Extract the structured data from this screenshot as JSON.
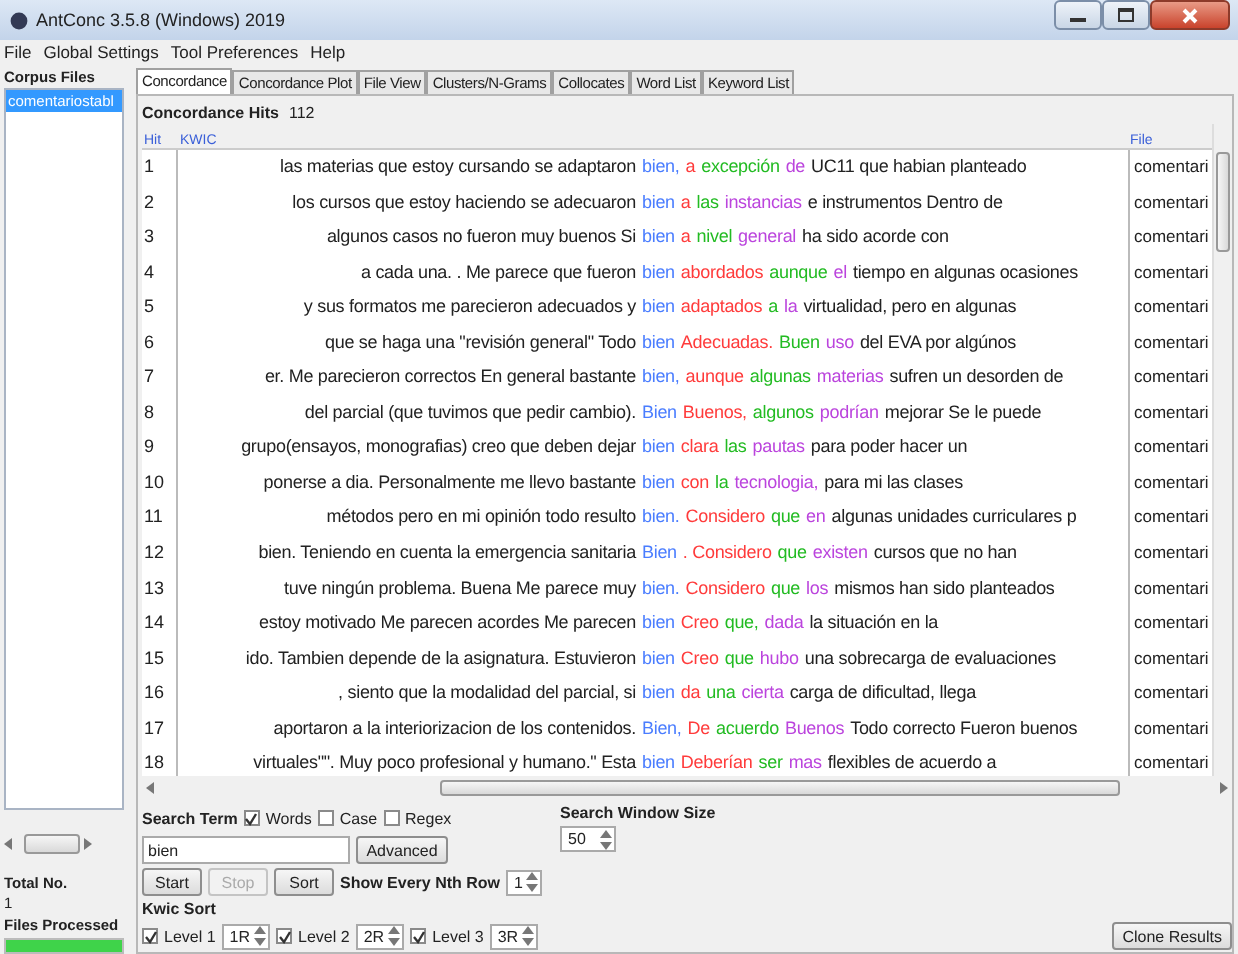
{
  "window": {
    "title": "AntConc 3.5.8 (Windows) 2019"
  },
  "menu": [
    "File",
    "Global Settings",
    "Tool Preferences",
    "Help"
  ],
  "sidebar": {
    "title": "Corpus Files",
    "files": [
      {
        "name": "comentariostabl",
        "selected": true
      }
    ],
    "total_label": "Total No.",
    "total": "1",
    "processed_label": "Files Processed",
    "progress": {
      "level": 1
    }
  },
  "tabs": [
    {
      "label": "Concordance",
      "selected": true
    },
    {
      "label": "Concordance Plot",
      "selected": false
    },
    {
      "label": "File View",
      "selected": false
    },
    {
      "label": "Clusters/N-Grams",
      "selected": false
    },
    {
      "label": "Collocates",
      "selected": false
    },
    {
      "label": "Word List",
      "selected": false
    },
    {
      "label": "Keyword List",
      "selected": false
    }
  ],
  "hits": {
    "label": "Concordance Hits",
    "count": "112"
  },
  "table": {
    "columns": [
      "Hit",
      "KWIC",
      "File"
    ],
    "rows": [
      {
        "hit": "1",
        "left": "las materias que estoy cursando se adaptaron",
        "right": [
          {
            "text": "bien,",
            "color": "#4a7dff"
          },
          {
            "text": "a",
            "color": "#ff3b3b"
          },
          {
            "text": "excepción",
            "color": "#22bb22"
          },
          {
            "text": "de",
            "color": "#bb44dd"
          },
          {
            "text": "UC11 que habian planteado",
            "color": "#222222"
          }
        ],
        "file": "comentari"
      },
      {
        "hit": "2",
        "left": "los cursos que estoy haciendo se adecuaron",
        "right": [
          {
            "text": "bien",
            "color": "#4a7dff"
          },
          {
            "text": "a",
            "color": "#ff3b3b"
          },
          {
            "text": "las",
            "color": "#22bb22"
          },
          {
            "text": "instancias",
            "color": "#bb44dd"
          },
          {
            "text": "e instrumentos Dentro de",
            "color": "#222222"
          }
        ],
        "file": "comentari"
      },
      {
        "hit": "3",
        "left": "algunos casos no fueron muy buenos  Si",
        "right": [
          {
            "text": "bien",
            "color": "#4a7dff"
          },
          {
            "text": "a",
            "color": "#ff3b3b"
          },
          {
            "text": "nivel",
            "color": "#22bb22"
          },
          {
            "text": "general",
            "color": "#bb44dd"
          },
          {
            "text": "ha sido acorde con",
            "color": "#222222"
          }
        ],
        "file": "comentari"
      },
      {
        "hit": "4",
        "left": "a cada una. . Me parece que fueron",
        "right": [
          {
            "text": "bien",
            "color": "#4a7dff"
          },
          {
            "text": "abordados",
            "color": "#ff3b3b"
          },
          {
            "text": "aunque",
            "color": "#22bb22"
          },
          {
            "text": "el",
            "color": "#bb44dd"
          },
          {
            "text": "tiempo en algunas ocasiones",
            "color": "#222222"
          }
        ],
        "file": "comentari"
      },
      {
        "hit": "5",
        "left": "y sus formatos me parecieron adecuados y",
        "right": [
          {
            "text": "bien",
            "color": "#4a7dff"
          },
          {
            "text": "adaptados",
            "color": "#ff3b3b"
          },
          {
            "text": "a",
            "color": "#22bb22"
          },
          {
            "text": "la",
            "color": "#bb44dd"
          },
          {
            "text": "virtualidad, pero en algunas",
            "color": "#222222"
          }
        ],
        "file": "comentari"
      },
      {
        "hit": "6",
        "left": "que se haga una \"revisión general\" Todo",
        "right": [
          {
            "text": "bien",
            "color": "#4a7dff"
          },
          {
            "text": "Adecuadas.",
            "color": "#ff3b3b"
          },
          {
            "text": "Buen",
            "color": "#22bb22"
          },
          {
            "text": "uso",
            "color": "#bb44dd"
          },
          {
            "text": "del EVA por algúnos",
            "color": "#222222"
          }
        ],
        "file": "comentari"
      },
      {
        "hit": "7",
        "left": "er.  Me parecieron correctos  En general bastante",
        "right": [
          {
            "text": "bien,",
            "color": "#4a7dff"
          },
          {
            "text": "aunque",
            "color": "#ff3b3b"
          },
          {
            "text": "algunas",
            "color": "#22bb22"
          },
          {
            "text": "materias",
            "color": "#bb44dd"
          },
          {
            "text": "sufren un desorden de",
            "color": "#222222"
          }
        ],
        "file": "comentari"
      },
      {
        "hit": "8",
        "left": "del parcial (que tuvimos que pedir cambio).",
        "right": [
          {
            "text": "Bien",
            "color": "#4a7dff"
          },
          {
            "text": "Buenos,",
            "color": "#ff3b3b"
          },
          {
            "text": "algunos",
            "color": "#22bb22"
          },
          {
            "text": "podrían",
            "color": "#bb44dd"
          },
          {
            "text": "mejorar  Se le puede",
            "color": "#222222"
          }
        ],
        "file": "comentari"
      },
      {
        "hit": "9",
        "left": "grupo(ensayos, monografias) creo que deben dejar",
        "right": [
          {
            "text": "bien",
            "color": "#4a7dff"
          },
          {
            "text": "clara",
            "color": "#ff3b3b"
          },
          {
            "text": "las",
            "color": "#22bb22"
          },
          {
            "text": "pautas",
            "color": "#bb44dd"
          },
          {
            "text": "para poder hacer un",
            "color": "#222222"
          }
        ],
        "file": "comentari"
      },
      {
        "hit": "10",
        "left": "ponerse a dia. Personalmente me llevo bastante",
        "right": [
          {
            "text": "bien",
            "color": "#4a7dff"
          },
          {
            "text": "con",
            "color": "#ff3b3b"
          },
          {
            "text": "la",
            "color": "#22bb22"
          },
          {
            "text": "tecnologia,",
            "color": "#bb44dd"
          },
          {
            "text": "para mi las clases",
            "color": "#222222"
          }
        ],
        "file": "comentari"
      },
      {
        "hit": "11",
        "left": "métodos pero en mi opinión todo resulto",
        "right": [
          {
            "text": "bien.",
            "color": "#4a7dff"
          },
          {
            "text": "Considero",
            "color": "#ff3b3b"
          },
          {
            "text": "que",
            "color": "#22bb22"
          },
          {
            "text": "en",
            "color": "#bb44dd"
          },
          {
            "text": "algunas unidades curriculares p",
            "color": "#222222"
          }
        ],
        "file": "comentari"
      },
      {
        "hit": "12",
        "left": "bien. Teniendo en cuenta la emergencia sanitaria",
        "right": [
          {
            "text": "Bien",
            "color": "#4a7dff"
          },
          {
            "text": ". Considero",
            "color": "#ff3b3b"
          },
          {
            "text": "que",
            "color": "#22bb22"
          },
          {
            "text": "existen",
            "color": "#bb44dd"
          },
          {
            "text": "cursos que no han",
            "color": "#222222"
          }
        ],
        "file": "comentari"
      },
      {
        "hit": "13",
        "left": "tuve ningún problema. Buena Me parece muy",
        "right": [
          {
            "text": "bien.",
            "color": "#4a7dff"
          },
          {
            "text": "Considero",
            "color": "#ff3b3b"
          },
          {
            "text": "que",
            "color": "#22bb22"
          },
          {
            "text": "los",
            "color": "#bb44dd"
          },
          {
            "text": "mismos han sido planteados",
            "color": "#222222"
          }
        ],
        "file": "comentari"
      },
      {
        "hit": "14",
        "left": "estoy motivado Me parecen acordes  Me parecen",
        "right": [
          {
            "text": "bien",
            "color": "#4a7dff"
          },
          {
            "text": "Creo",
            "color": "#ff3b3b"
          },
          {
            "text": "que,",
            "color": "#22bb22"
          },
          {
            "text": "dada",
            "color": "#bb44dd"
          },
          {
            "text": "la situación en la",
            "color": "#222222"
          }
        ],
        "file": "comentari"
      },
      {
        "hit": "15",
        "left": "ido. Tambien depende de la asignatura. Estuvieron",
        "right": [
          {
            "text": "bien",
            "color": "#4a7dff"
          },
          {
            "text": "Creo",
            "color": "#ff3b3b"
          },
          {
            "text": "que",
            "color": "#22bb22"
          },
          {
            "text": "hubo",
            "color": "#bb44dd"
          },
          {
            "text": "una sobrecarga de evaluaciones",
            "color": "#222222"
          }
        ],
        "file": "comentari"
      },
      {
        "hit": "16",
        "left": ", siento que la modalidad del parcial, si",
        "right": [
          {
            "text": "bien",
            "color": "#4a7dff"
          },
          {
            "text": "da",
            "color": "#ff3b3b"
          },
          {
            "text": "una",
            "color": "#22bb22"
          },
          {
            "text": "cierta",
            "color": "#bb44dd"
          },
          {
            "text": "carga de dificultad, llega",
            "color": "#222222"
          }
        ],
        "file": "comentari"
      },
      {
        "hit": "17",
        "left": "aportaron a la interiorizacion de los contenidos.",
        "right": [
          {
            "text": "Bien,",
            "color": "#4a7dff"
          },
          {
            "text": "De",
            "color": "#ff3b3b"
          },
          {
            "text": "acuerdo",
            "color": "#22bb22"
          },
          {
            "text": "Buenos",
            "color": "#bb44dd"
          },
          {
            "text": "Todo correcto Fueron buenos",
            "color": "#222222"
          }
        ],
        "file": "comentari"
      },
      {
        "hit": "18",
        "left": "virtuales\"\".  Muy poco profesional y humano.\" Esta",
        "right": [
          {
            "text": "bien",
            "color": "#4a7dff"
          },
          {
            "text": "Deberían",
            "color": "#ff3b3b"
          },
          {
            "text": "ser",
            "color": "#22bb22"
          },
          {
            "text": "mas",
            "color": "#bb44dd"
          },
          {
            "text": "flexibles de acuerdo a",
            "color": "#222222"
          }
        ],
        "file": "comentari"
      }
    ]
  },
  "search": {
    "label": "Search Term",
    "options": [
      {
        "label": "Words",
        "checked": true
      },
      {
        "label": "Case",
        "checked": false
      },
      {
        "label": "Regex",
        "checked": false
      }
    ],
    "value": "bien",
    "advanced": "Advanced",
    "buttons": [
      {
        "label": "Start",
        "disabled": false
      },
      {
        "label": "Stop",
        "disabled": true
      },
      {
        "label": "Sort",
        "disabled": false
      }
    ],
    "nth_label": "Show Every Nth Row",
    "nth": "1"
  },
  "window_size": {
    "label": "Search Window Size",
    "value": "50"
  },
  "kwic_sort": {
    "label": "Kwic Sort",
    "levels": [
      {
        "label": "Level 1",
        "checked": true,
        "value": "1R"
      },
      {
        "label": "Level 2",
        "checked": true,
        "value": "2R"
      },
      {
        "label": "Level 3",
        "checked": true,
        "value": "3R"
      }
    ]
  },
  "clone_button": "Clone Results"
}
